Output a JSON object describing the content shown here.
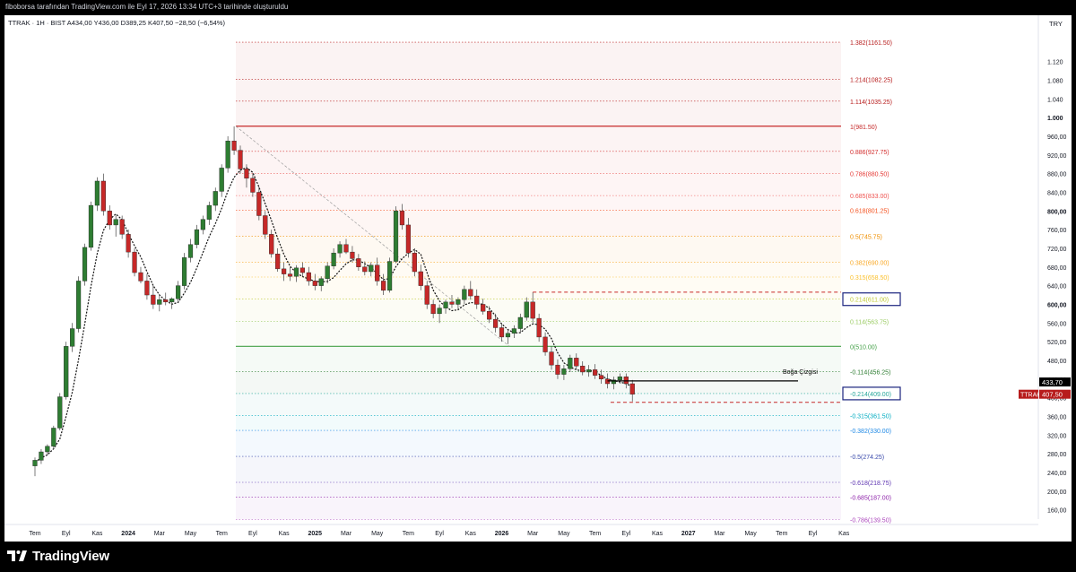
{
  "header": {
    "publisher_line": "fiboborsa tarafından TradingView.com ile Eyl 17, 2026 13:34 UTC+3 tarihinde oluşturuldu",
    "symbol_line": "TTRAK · 1H · BIST  A434,00  Y436,00  D389,25  K407,50  −28,50 (−6,54%)"
  },
  "brand": {
    "name": "TradingView"
  },
  "chart_data": {
    "type": "candlestick",
    "symbol": "TTRAK",
    "currency_label": "TRY",
    "price_scale_ticks": [
      "1.120",
      "1.080",
      "1.040",
      "1.000",
      "960,00",
      "920,00",
      "880,00",
      "840,00",
      "800,00",
      "760,00",
      "720,00",
      "680,00",
      "640,00",
      "600,00",
      "560,00",
      "520,00",
      "480,00",
      "440,00",
      "400,00",
      "360,00",
      "320,00",
      "280,00",
      "240,00",
      "200,00",
      "160,00"
    ],
    "ylim": [
      140,
      1200
    ],
    "time_axis_labels": [
      {
        "label": "Tem",
        "t": 0.0
      },
      {
        "label": "Eyl",
        "t": 2.0
      },
      {
        "label": "Kas",
        "t": 4.0
      },
      {
        "label": "2024",
        "t": 6.0
      },
      {
        "label": "Mar",
        "t": 8.0
      },
      {
        "label": "May",
        "t": 10.0
      },
      {
        "label": "Tem",
        "t": 12.0
      },
      {
        "label": "Eyl",
        "t": 14.0
      },
      {
        "label": "Kas",
        "t": 16.0
      },
      {
        "label": "2025",
        "t": 18.0
      },
      {
        "label": "Mar",
        "t": 20.0
      },
      {
        "label": "May",
        "t": 22.0
      },
      {
        "label": "Tem",
        "t": 24.0
      },
      {
        "label": "Eyl",
        "t": 26.0
      },
      {
        "label": "Kas",
        "t": 28.0
      },
      {
        "label": "2026",
        "t": 30.0
      },
      {
        "label": "Mar",
        "t": 32.0
      },
      {
        "label": "May",
        "t": 34.0
      },
      {
        "label": "Tem",
        "t": 36.0
      },
      {
        "label": "Eyl",
        "t": 38.0
      },
      {
        "label": "Kas",
        "t": 40.0
      },
      {
        "label": "2027",
        "t": 42.0
      },
      {
        "label": "Mar",
        "t": 44.0
      },
      {
        "label": "May",
        "t": 46.0
      },
      {
        "label": "Tem",
        "t": 48.0
      },
      {
        "label": "Eyl",
        "t": 50.0
      },
      {
        "label": "Kas",
        "t": 52.0
      }
    ],
    "fib_levels": [
      {
        "ratio": "1.382",
        "price": 1161.5,
        "text": "1.382(1161.50)",
        "color": "#b71c1c"
      },
      {
        "ratio": "1.214",
        "price": 1082.25,
        "text": "1.214(1082.25)",
        "color": "#b71c1c"
      },
      {
        "ratio": "1.114",
        "price": 1035.25,
        "text": "1.114(1035.25)",
        "color": "#b71c1c"
      },
      {
        "ratio": "1",
        "price": 981.5,
        "text": "1(981.50)",
        "color": "#c62828"
      },
      {
        "ratio": "0.886",
        "price": 927.75,
        "text": "0.886(927.75)",
        "color": "#d32f2f"
      },
      {
        "ratio": "0.786",
        "price": 880.5,
        "text": "0.786(880.50)",
        "color": "#e53935"
      },
      {
        "ratio": "0.685",
        "price": 833.0,
        "text": "0.685(833.00)",
        "color": "#ef5350"
      },
      {
        "ratio": "0.618",
        "price": 801.25,
        "text": "0.618(801.25)",
        "color": "#f4511e"
      },
      {
        "ratio": "0.5",
        "price": 745.75,
        "text": "0.5(745.75)",
        "color": "#ef8f00"
      },
      {
        "ratio": "0.382",
        "price": 690.0,
        "text": "0.382(690.00)",
        "color": "#f9a825"
      },
      {
        "ratio": "0.315",
        "price": 658.5,
        "text": "0.315(658.50)",
        "color": "#fbc02d"
      },
      {
        "ratio": "0.214",
        "price": 611.0,
        "text": "0.214(611.00)",
        "color": "#c0ca33"
      },
      {
        "ratio": "0.114",
        "price": 563.75,
        "text": "0.114(563.75)",
        "color": "#9ccc65"
      },
      {
        "ratio": "0",
        "price": 510.0,
        "text": "0(510.00)",
        "color": "#43a047"
      },
      {
        "ratio": "-0.114",
        "price": 456.25,
        "text": "-0.114(456.25)",
        "color": "#2e7d32"
      },
      {
        "ratio": "-0.214",
        "price": 409.0,
        "text": "-0.214(409.00)",
        "color": "#26a69a"
      },
      {
        "ratio": "-0.315",
        "price": 361.5,
        "text": "-0.315(361.50)",
        "color": "#00acc1"
      },
      {
        "ratio": "-0.382",
        "price": 330.0,
        "text": "-0.382(330.00)",
        "color": "#1e88e5"
      },
      {
        "ratio": "-0.5",
        "price": 274.25,
        "text": "-0.5(274.25)",
        "color": "#3949ab"
      },
      {
        "ratio": "-0.618",
        "price": 218.75,
        "text": "-0.618(218.75)",
        "color": "#5e35b1"
      },
      {
        "ratio": "-0.685",
        "price": 187.0,
        "text": "-0.685(187.00)",
        "color": "#8e24aa"
      },
      {
        "ratio": "-0.786",
        "price": 139.5,
        "text": "-0.786(139.50)",
        "color": "#ab47bc"
      }
    ],
    "annotations": {
      "bull_line_label": "Boğa Çizgisi",
      "bull_line_price": 436,
      "resistance_dashed_price": 626,
      "support_dashed_price": 390
    },
    "price_badges": [
      {
        "label": "",
        "value": "433,70",
        "price": 433.7,
        "bg": "#000000",
        "fg": "#ffffff"
      },
      {
        "label": "TTRAK",
        "value": "407,50",
        "price": 407.5,
        "bg": "#b71c1c",
        "fg": "#ffffff"
      }
    ],
    "candles_ohlc": [
      [
        0,
        254,
        272,
        232,
        266
      ],
      [
        0.4,
        266,
        290,
        258,
        284
      ],
      [
        0.8,
        284,
        300,
        276,
        296
      ],
      [
        1.2,
        296,
        340,
        290,
        335
      ],
      [
        1.6,
        335,
        410,
        330,
        402
      ],
      [
        2.0,
        402,
        520,
        396,
        510
      ],
      [
        2.4,
        510,
        560,
        498,
        548
      ],
      [
        2.8,
        548,
        660,
        540,
        650
      ],
      [
        3.2,
        650,
        730,
        640,
        722
      ],
      [
        3.6,
        722,
        820,
        715,
        812
      ],
      [
        4.0,
        812,
        872,
        800,
        864
      ],
      [
        4.4,
        864,
        880,
        790,
        800
      ],
      [
        4.8,
        800,
        812,
        760,
        770
      ],
      [
        5.2,
        770,
        790,
        745,
        782
      ],
      [
        5.6,
        782,
        790,
        740,
        750
      ],
      [
        6.0,
        750,
        760,
        700,
        712
      ],
      [
        6.4,
        712,
        720,
        660,
        668
      ],
      [
        6.8,
        668,
        680,
        645,
        650
      ],
      [
        7.2,
        650,
        665,
        610,
        620
      ],
      [
        7.6,
        620,
        640,
        590,
        600
      ],
      [
        8.0,
        600,
        618,
        585,
        610
      ],
      [
        8.4,
        610,
        625,
        598,
        605
      ],
      [
        8.8,
        605,
        615,
        590,
        612
      ],
      [
        9.2,
        612,
        650,
        605,
        640
      ],
      [
        9.6,
        640,
        710,
        632,
        700
      ],
      [
        10.0,
        700,
        740,
        690,
        728
      ],
      [
        10.4,
        728,
        770,
        720,
        760
      ],
      [
        10.8,
        760,
        790,
        750,
        782
      ],
      [
        11.2,
        782,
        820,
        770,
        812
      ],
      [
        11.6,
        812,
        850,
        800,
        842
      ],
      [
        12.0,
        842,
        900,
        830,
        892
      ],
      [
        12.4,
        892,
        960,
        882,
        950
      ],
      [
        12.8,
        950,
        981,
        920,
        930
      ],
      [
        13.2,
        930,
        940,
        880,
        890
      ],
      [
        13.6,
        890,
        900,
        850,
        870
      ],
      [
        14.0,
        870,
        880,
        830,
        840
      ],
      [
        14.4,
        840,
        852,
        780,
        790
      ],
      [
        14.8,
        790,
        800,
        740,
        750
      ],
      [
        15.2,
        750,
        760,
        700,
        708
      ],
      [
        15.6,
        708,
        720,
        670,
        676
      ],
      [
        16.0,
        676,
        690,
        650,
        665
      ],
      [
        16.4,
        665,
        680,
        650,
        660
      ],
      [
        16.8,
        660,
        684,
        648,
        678
      ],
      [
        17.2,
        678,
        690,
        660,
        668
      ],
      [
        17.6,
        668,
        680,
        640,
        650
      ],
      [
        18.0,
        650,
        665,
        630,
        640
      ],
      [
        18.4,
        640,
        660,
        628,
        655
      ],
      [
        18.8,
        655,
        690,
        645,
        682
      ],
      [
        19.2,
        682,
        720,
        675,
        710
      ],
      [
        19.6,
        710,
        735,
        700,
        728
      ],
      [
        20.0,
        728,
        740,
        708,
        712
      ],
      [
        20.4,
        712,
        725,
        690,
        698
      ],
      [
        20.8,
        698,
        708,
        672,
        680
      ],
      [
        21.2,
        680,
        692,
        662,
        670
      ],
      [
        21.6,
        670,
        690,
        660,
        684
      ],
      [
        22.0,
        684,
        700,
        640,
        650
      ],
      [
        22.4,
        650,
        665,
        620,
        630
      ],
      [
        22.8,
        630,
        700,
        625,
        692
      ],
      [
        23.2,
        692,
        810,
        688,
        800
      ],
      [
        23.6,
        800,
        815,
        760,
        770
      ],
      [
        24.0,
        770,
        785,
        700,
        710
      ],
      [
        24.4,
        710,
        720,
        660,
        670
      ],
      [
        24.8,
        670,
        685,
        630,
        640
      ],
      [
        25.2,
        640,
        650,
        590,
        600
      ],
      [
        25.6,
        600,
        610,
        570,
        580
      ],
      [
        26.0,
        580,
        600,
        560,
        592
      ],
      [
        26.4,
        592,
        610,
        580,
        605
      ],
      [
        26.8,
        605,
        620,
        592,
        600
      ],
      [
        27.2,
        600,
        615,
        588,
        610
      ],
      [
        27.6,
        610,
        640,
        600,
        632
      ],
      [
        28.0,
        632,
        650,
        610,
        618
      ],
      [
        28.4,
        618,
        632,
        590,
        600
      ],
      [
        28.8,
        600,
        612,
        578,
        585
      ],
      [
        29.2,
        585,
        596,
        560,
        568
      ],
      [
        29.6,
        568,
        580,
        540,
        550
      ],
      [
        30.0,
        550,
        560,
        520,
        530
      ],
      [
        30.4,
        530,
        545,
        515,
        538
      ],
      [
        30.8,
        538,
        555,
        528,
        548
      ],
      [
        31.2,
        548,
        580,
        540,
        572
      ],
      [
        31.6,
        572,
        615,
        565,
        605
      ],
      [
        32.0,
        605,
        626,
        560,
        570
      ],
      [
        32.4,
        570,
        580,
        520,
        530
      ],
      [
        32.8,
        530,
        540,
        490,
        498
      ],
      [
        33.2,
        498,
        510,
        460,
        470
      ],
      [
        33.6,
        470,
        482,
        440,
        450
      ],
      [
        34.0,
        450,
        470,
        438,
        462
      ],
      [
        34.4,
        462,
        492,
        455,
        485
      ],
      [
        34.8,
        485,
        495,
        460,
        468
      ],
      [
        35.2,
        468,
        478,
        448,
        455
      ],
      [
        35.6,
        455,
        470,
        445,
        460
      ],
      [
        36.0,
        460,
        472,
        440,
        448
      ],
      [
        36.4,
        448,
        460,
        430,
        440
      ],
      [
        36.8,
        440,
        452,
        420,
        430
      ],
      [
        37.2,
        430,
        445,
        418,
        438
      ],
      [
        37.6,
        438,
        452,
        430,
        445
      ],
      [
        38.0,
        445,
        452,
        420,
        430
      ],
      [
        38.4,
        430,
        438,
        392,
        407.5
      ]
    ]
  }
}
